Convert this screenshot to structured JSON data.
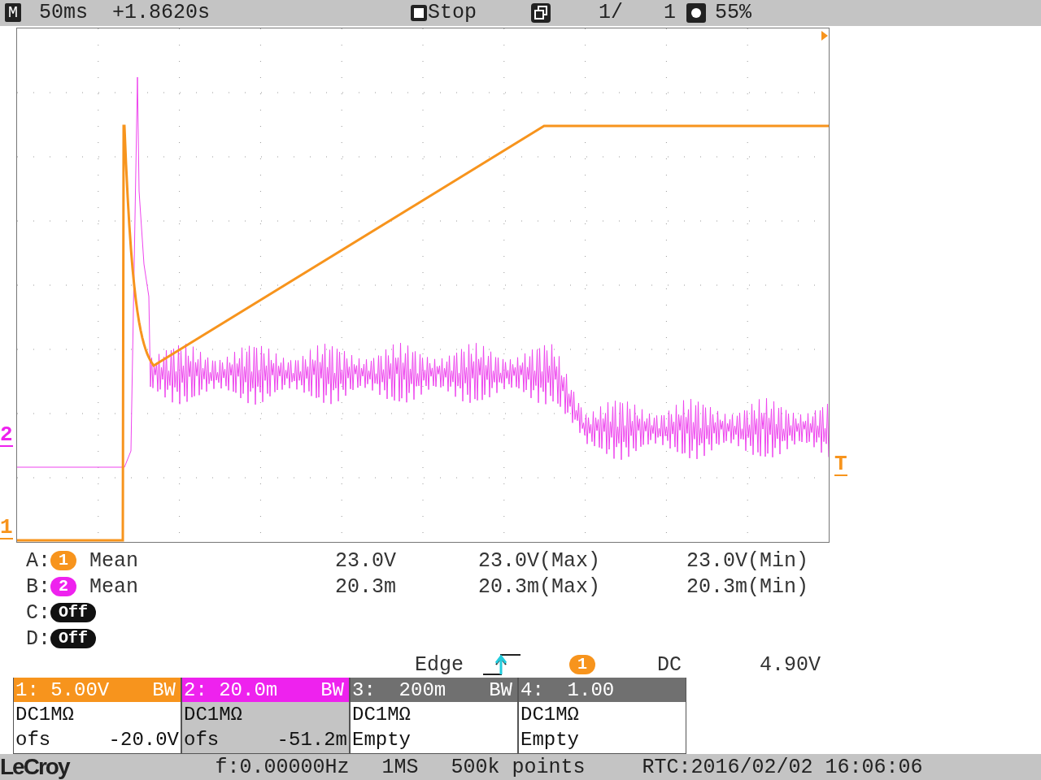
{
  "top_bar": {
    "mode": "M",
    "timebase": "50ms",
    "delay": "+1.8620s",
    "run_state": "Stop",
    "history": "1/",
    "history_total": "1",
    "intensity": "55%"
  },
  "markers": {
    "channel_2": "2",
    "channel_1": "1",
    "trigger": "T"
  },
  "measurements": [
    {
      "slot": "A:",
      "kind": "channel",
      "badge": "1",
      "color": "#f7941d",
      "type": "Mean",
      "value": "23.0V",
      "max": "23.0V(Max)",
      "min": "23.0V(Min)"
    },
    {
      "slot": "B:",
      "kind": "channel",
      "badge": "2",
      "color": "#ee22ee",
      "type": "Mean",
      "value": "20.3m",
      "max": "20.3m(Max)",
      "min": "20.3m(Min)"
    },
    {
      "slot": "C:",
      "kind": "off",
      "badge": "Off"
    },
    {
      "slot": "D:",
      "kind": "off",
      "badge": "Off"
    }
  ],
  "trigger": {
    "type": "Edge",
    "source": "1",
    "coupling": "DC",
    "level": "4.90V"
  },
  "channels": [
    {
      "header": "1: 5.00V",
      "bw": "BW",
      "color": "#f7941d",
      "selected": false,
      "coupling": "DC1MΩ",
      "offset_label": "ofs",
      "offset": "-20.0V"
    },
    {
      "header": "2: 20.0m",
      "bw": "BW",
      "color": "#ee22ee",
      "selected": true,
      "coupling": "DC1MΩ",
      "offset_label": "ofs",
      "offset": "-51.2m"
    },
    {
      "header": "3:  200m",
      "bw": "BW",
      "color": "#707070",
      "selected": false,
      "coupling": "DC1MΩ",
      "status": "Empty"
    },
    {
      "header": "4:  1.00",
      "color": "#707070",
      "selected": false,
      "coupling": "DC1MΩ",
      "status": "Empty"
    }
  ],
  "status_bar": {
    "brand": "LeCroy",
    "frequency": "f:0.00000Hz",
    "sample_rate": "1MS",
    "points": "500k points",
    "clock": "RTC:2016/02/02 16:06:06"
  }
}
